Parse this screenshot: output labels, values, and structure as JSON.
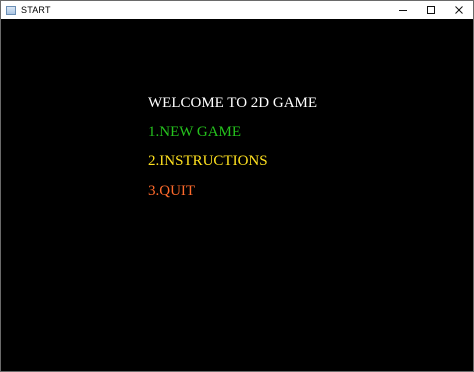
{
  "window": {
    "title": "START",
    "controls": {
      "minimize_icon": "minimize-icon",
      "maximize_icon": "maximize-icon",
      "close_icon": "close-icon"
    }
  },
  "menu": {
    "welcome": "WELCOME TO 2D GAME",
    "items": [
      {
        "label": "1.NEW GAME",
        "color": "#25c11d"
      },
      {
        "label": "2.INSTRUCTIONS",
        "color": "#ffe11f"
      },
      {
        "label": "3.QUIT",
        "color": "#ff6a2b"
      }
    ]
  },
  "colors": {
    "background": "#000000",
    "welcome_text": "#ffffff"
  }
}
